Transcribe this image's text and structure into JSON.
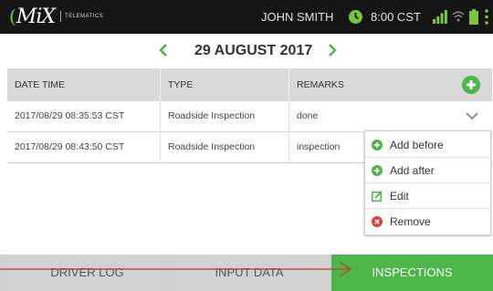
{
  "header": {
    "brand": "MiX",
    "brand_sub": "TELEMATICS",
    "user_name": "JOHN SMITH",
    "time": "8:00 CST",
    "icons": [
      "clock-icon",
      "signal-icon",
      "wifi-icon",
      "battery-icon",
      "menu-icon"
    ]
  },
  "date_nav": {
    "date": "29 AUGUST 2017"
  },
  "table": {
    "columns": [
      "DATE TIME",
      "TYPE",
      "REMARKS"
    ],
    "rows": [
      {
        "datetime": "2017/08/29 08:35:53 CST",
        "type": "Roadside Inspection",
        "remarks": "done"
      },
      {
        "datetime": "2017/08/29 08:43:50 CST",
        "type": "Roadside Inspection",
        "remarks": "inspection"
      }
    ]
  },
  "context_menu": {
    "items": [
      {
        "label": "Add before",
        "icon": "plus-circle-icon"
      },
      {
        "label": "Add after",
        "icon": "plus-circle-icon"
      },
      {
        "label": "Edit",
        "icon": "edit-icon"
      },
      {
        "label": "Remove",
        "icon": "remove-circle-icon"
      }
    ]
  },
  "bottom_tabs": {
    "tabs": [
      "DRIVER LOG",
      "INPUT DATA",
      "INSPECTIONS"
    ],
    "active": "INSPECTIONS"
  },
  "colors": {
    "accent_green": "#4cb649",
    "remove_red": "#e0403a",
    "topbar_bg": "#151515",
    "annotation_red": "#c0392b"
  }
}
